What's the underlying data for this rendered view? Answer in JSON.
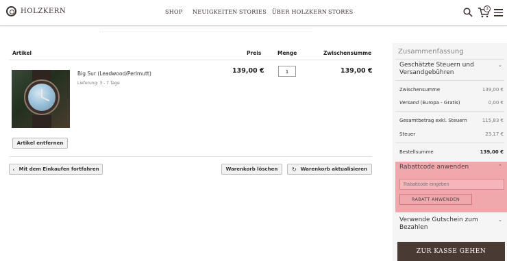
{
  "header": {
    "logo_text": "HOLZKERN",
    "nav": [
      "SHOP",
      "NEUIGKEITEN",
      "STORIES",
      "ÜBER HOLZKERN",
      "STORES"
    ],
    "cart_count": "1"
  },
  "cart": {
    "columns": {
      "artikel": "Artikel",
      "preis": "Preis",
      "menge": "Menge",
      "zwischensumme": "Zwischensumme"
    },
    "item": {
      "name": "Big Sur (Leadwood/Perlmutt)",
      "delivery": "Lieferung: 3 - 7 Tage",
      "price": "139,00 €",
      "quantity": "1",
      "subtotal": "139,00 €"
    },
    "remove_label": "Artikel entfernen",
    "continue_label": "Mit dem Einkaufen fortfahren",
    "clear_label": "Warenkorb löschen",
    "update_label": "Warenkorb aktualisieren"
  },
  "summary": {
    "title": "Zusammenfassung",
    "tax_estimate_title": "Geschätzte Steuern und Versandgebühren",
    "rows": {
      "subtotal_label": "Zwischensumme",
      "subtotal_value": "139,00 €",
      "shipping_label_italic": "Versand",
      "shipping_label_rest": " (Europa - Gratis)",
      "shipping_value": "0,00 €",
      "net_label": "Gesamtbetrag exkl. Steuern",
      "net_value": "115,83 €",
      "tax_label": "Steuer",
      "tax_value": "23,17 €",
      "total_label": "Bestellsumme",
      "total_value": "139,00 €"
    },
    "discount": {
      "title": "Rabattcode anwenden",
      "placeholder": "Rabattcode eingeben",
      "apply_label": "RABATT ANWENDEN"
    },
    "voucher_title": "Verwende Gutschein zum Bezahlen",
    "checkout_label": "ZUR KASSE GEHEN"
  },
  "colors": {
    "brand_dark": "#4a3a34",
    "discount_highlight": "#f0a8ad",
    "summary_bg": "#f5f5f5"
  },
  "icons": [
    "logo-icon",
    "search-icon",
    "cart-icon",
    "menu-icon",
    "chevron-left-icon",
    "refresh-icon",
    "chevron-down-icon",
    "chevron-up-icon"
  ]
}
